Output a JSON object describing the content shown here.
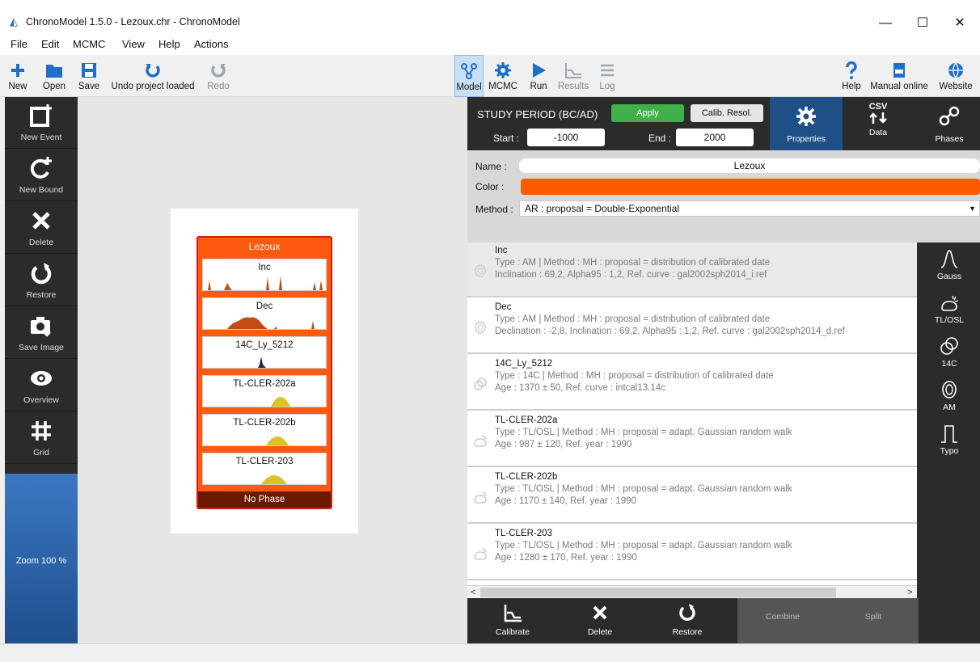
{
  "window": {
    "title": "ChronoModel 1.5.0 - Lezoux.chr - ChronoModel",
    "minimize": "—",
    "maximize": "☐",
    "close": "✕"
  },
  "menu": [
    "File",
    "Edit",
    "MCMC",
    "View",
    "Help",
    "Actions"
  ],
  "toolbar": {
    "new": "New",
    "open": "Open",
    "save": "Save",
    "undo": "Undo project loaded",
    "redo": "Redo",
    "model": "Model",
    "mcmc": "MCMC",
    "run": "Run",
    "results": "Results",
    "log": "Log",
    "help": "Help",
    "manual": "Manual online",
    "website": "Website"
  },
  "left_tools": {
    "new_event": "New Event",
    "new_bound": "New Bound",
    "delete": "Delete",
    "restore": "Restore",
    "save_image": "Save Image",
    "overview": "Overview",
    "grid": "Grid",
    "zoom": "Zoom 100 %"
  },
  "event": {
    "name": "Lezoux",
    "phase": "No Phase",
    "dates": [
      "Inc",
      "Dec",
      "14C_Ly_5212",
      "TL-CLER-202a",
      "TL-CLER-202b",
      "TL-CLER-203"
    ]
  },
  "study": {
    "label": "STUDY PERIOD (BC/AD)",
    "apply": "Apply",
    "calib": "Calib. Resol.",
    "start_label": "Start :",
    "start": "-1000",
    "end_label": "End :",
    "end": "2000"
  },
  "tabs": {
    "properties": "Properties",
    "data_top": "CSV",
    "data": "Data",
    "phases": "Phases"
  },
  "props": {
    "name_label": "Name :",
    "name": "Lezoux",
    "color_label": "Color :",
    "color": "#ff5a00",
    "method_label": "Method :",
    "method": "AR : proposal = Double-Exponential"
  },
  "dates": [
    {
      "name": "Inc",
      "line1": "Type : AM | Method : MH : proposal = distribution of calibrated date",
      "line2": "Inclination : 69,2, Alpha95 : 1,2, Ref. curve : gal2002sph2014_i.ref"
    },
    {
      "name": "Dec",
      "line1": "Type : AM | Method : MH : proposal = distribution of calibrated date",
      "line2": "Declination : -2,8, Inclination : 69,2, Alpha95 : 1,2, Ref. curve : gal2002sph2014_d.ref"
    },
    {
      "name": "14C_Ly_5212",
      "line1": "Type : 14C | Method : MH : proposal = distribution of calibrated date",
      "line2": "Age : 1370 ± 50, Ref. curve : intcal13.14c"
    },
    {
      "name": "TL-CLER-202a",
      "line1": "Type : TL/OSL | Method : MH : proposal = adapt. Gaussian random walk",
      "line2": "Age : 987 ± 120, Ref. year : 1990"
    },
    {
      "name": "TL-CLER-202b",
      "line1": "Type : TL/OSL | Method : MH : proposal = adapt. Gaussian random walk",
      "line2": "Age : 1170 ± 140, Ref. year : 1990"
    },
    {
      "name": "TL-CLER-203",
      "line1": "Type : TL/OSL | Method : MH : proposal = adapt. Gaussian random walk",
      "line2": "Age : 1280 ± 170, Ref. year : 1990"
    }
  ],
  "date_tools": {
    "gauss": "Gauss",
    "tlosl": "TL/OSL",
    "c14": "14C",
    "am": "AM",
    "typo": "Typo"
  },
  "bottom_tools": {
    "calibrate": "Calibrate",
    "delete": "Delete",
    "restore": "Restore",
    "combine": "Combine",
    "split": "Split"
  },
  "colors": {
    "accent": "#1e4f86",
    "event": "#ff5a10",
    "apply": "#3fb04a"
  }
}
